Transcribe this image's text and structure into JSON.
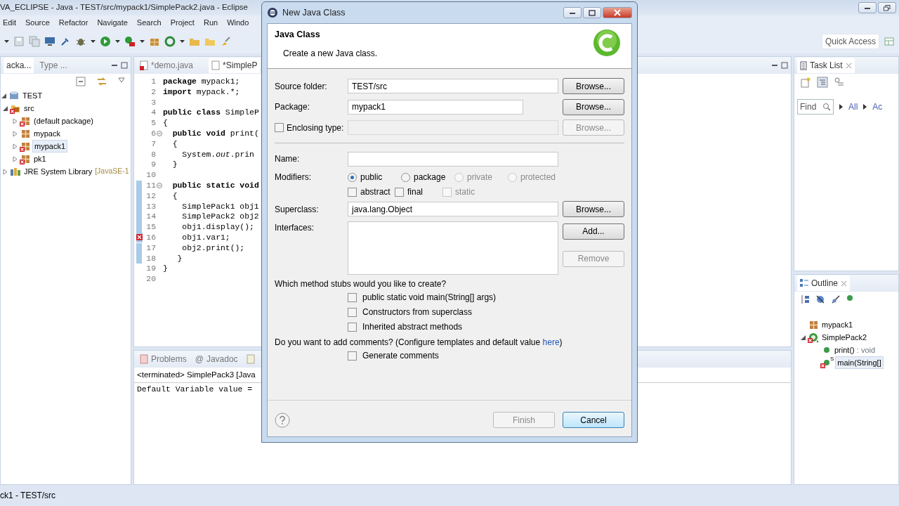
{
  "ide": {
    "title": "VA_ECLIPSE - Java - TEST/src/mypack1/SimplePack2.java - Eclipse",
    "menu": [
      "Edit",
      "Source",
      "Refactor",
      "Navigate",
      "Search",
      "Project",
      "Run",
      "Windo"
    ],
    "quick_access": "Quick Access"
  },
  "package_explorer": {
    "tabs": [
      {
        "label": "acka...",
        "selected": true
      },
      {
        "label": "Type ...",
        "selected": false
      }
    ],
    "tree": [
      {
        "label": "TEST",
        "kind": "project",
        "error": false,
        "selected": false,
        "expanded": true,
        "children": [
          {
            "label": "src",
            "kind": "folder",
            "error": true,
            "selected": false,
            "expanded": true,
            "children": [
              {
                "label": "(default package)",
                "kind": "package",
                "error": true,
                "selected": false,
                "expanded": false
              },
              {
                "label": "mypack",
                "kind": "package",
                "error": false,
                "selected": false,
                "expanded": false
              },
              {
                "label": "mypack1",
                "kind": "package",
                "error": true,
                "selected": true,
                "expanded": false
              },
              {
                "label": "pk1",
                "kind": "package",
                "error": true,
                "selected": false,
                "expanded": false
              }
            ]
          },
          {
            "label": "JRE System Library",
            "decoration": "[JavaSE-1",
            "kind": "library",
            "error": false,
            "selected": false,
            "expanded": false
          }
        ]
      }
    ]
  },
  "editor": {
    "tabs": [
      {
        "label": "*demo.java",
        "error": true,
        "selected": false
      },
      {
        "label": "*SimpleP",
        "error": false,
        "selected": true
      }
    ],
    "lines": [
      {
        "number": "1",
        "text": "**package** mypack1;"
      },
      {
        "number": "2",
        "text": "**import** mypack.*;"
      },
      {
        "number": "3"
      },
      {
        "number": "4",
        "text": "**public class** SimpleP"
      },
      {
        "number": "5",
        "text": "{"
      },
      {
        "number": "6",
        "fold": true,
        "text": "  **public void** print("
      },
      {
        "number": "7",
        "text": "  {"
      },
      {
        "number": "8",
        "text": "    System.*out*.prin"
      },
      {
        "number": "9",
        "text": "  }"
      },
      {
        "number": "10"
      },
      {
        "number": "11",
        "fold": true,
        "changed": true,
        "text": "  **public static void**"
      },
      {
        "number": "12",
        "changed": true,
        "text": "  {"
      },
      {
        "number": "13",
        "changed": true,
        "text": "    SimplePack1 obj1"
      },
      {
        "number": "14",
        "changed": true,
        "text": "    SimplePack2 obj2"
      },
      {
        "number": "15",
        "changed": true,
        "text": "    obj1.display();"
      },
      {
        "number": "16",
        "changed": true,
        "error": true,
        "text": "    obj1.var1;"
      },
      {
        "number": "17",
        "changed": true,
        "text": "    obj2.print();"
      },
      {
        "number": "18",
        "changed": true,
        "text": "   }"
      },
      {
        "number": "19",
        "text": "}"
      },
      {
        "number": "20"
      }
    ]
  },
  "console": {
    "tabs": [
      {
        "kind": "problems",
        "label": "Problems",
        "selected": false
      },
      {
        "kind": "javadoc",
        "glyph": "@",
        "label": "Javadoc",
        "selected": false
      },
      {
        "kind": "declaration",
        "selected": false
      }
    ],
    "header": "<terminated> SimplePack3 [Java",
    "output": "Default Variable value ="
  },
  "task_list": {
    "title": "Task List",
    "find_placeholder": "Find",
    "filters": [
      "All",
      "Ac"
    ]
  },
  "outline": {
    "title": "Outline",
    "tree": [
      {
        "label": "mypack1",
        "kind": "package",
        "error": false,
        "selected": false
      },
      {
        "label": "SimplePack2",
        "kind": "class",
        "error": true,
        "selected": false,
        "expanded": true,
        "children": [
          {
            "label": "print()",
            "type": ": void",
            "kind": "method",
            "error": false,
            "selected": false
          },
          {
            "label": "main(String[]",
            "mark": "S",
            "kind": "method",
            "error": true,
            "selected": true
          }
        ]
      }
    ]
  },
  "status_bar": "ck1 - TEST/src",
  "dialog": {
    "title": "New Java Class",
    "heading": "Java Class",
    "description": "Create a new Java class.",
    "source_folder": {
      "label": "Source folder:",
      "value": "TEST/src",
      "button": "Browse..."
    },
    "package": {
      "label": "Package:",
      "value": "mypack1",
      "button": "Browse..."
    },
    "enclosing_type": {
      "label": "Enclosing type:",
      "checked": false,
      "button": "Browse..."
    },
    "name": {
      "label": "Name:"
    },
    "modifiers": {
      "label": "Modifiers:",
      "access": [
        {
          "label": "public",
          "selected": true,
          "disabled": false
        },
        {
          "label": "package",
          "selected": false,
          "disabled": false
        },
        {
          "label": "private",
          "selected": false,
          "disabled": true
        },
        {
          "label": "protected",
          "selected": false,
          "disabled": true
        }
      ],
      "flags": [
        {
          "label": "abstract",
          "checked": false,
          "disabled": false
        },
        {
          "label": "final",
          "checked": false,
          "disabled": false
        },
        {
          "label": "static",
          "checked": false,
          "disabled": true
        }
      ]
    },
    "superclass": {
      "label": "Superclass:",
      "value": "java.lang.Object",
      "button": "Browse..."
    },
    "interfaces": {
      "label": "Interfaces:",
      "buttons": [
        {
          "label": "Add...",
          "disabled": false
        },
        {
          "label": "Remove",
          "disabled": true
        }
      ]
    },
    "stubs": {
      "question": "Which method stubs would you like to create?",
      "options": [
        {
          "label": "public static void main(String[] args)",
          "checked": false
        },
        {
          "label": "Constructors from superclass",
          "checked": false
        },
        {
          "label": "Inherited abstract methods",
          "checked": false
        }
      ]
    },
    "comments": {
      "question": "Do you want to add comments? (Configure templates and default value",
      "link": "here",
      "after": ")",
      "generate": {
        "label": "Generate comments",
        "checked": false
      }
    },
    "buttons": [
      {
        "label": "Finish",
        "disabled": true,
        "focused": false
      },
      {
        "label": "Cancel",
        "disabled": false,
        "focused": true
      }
    ]
  }
}
